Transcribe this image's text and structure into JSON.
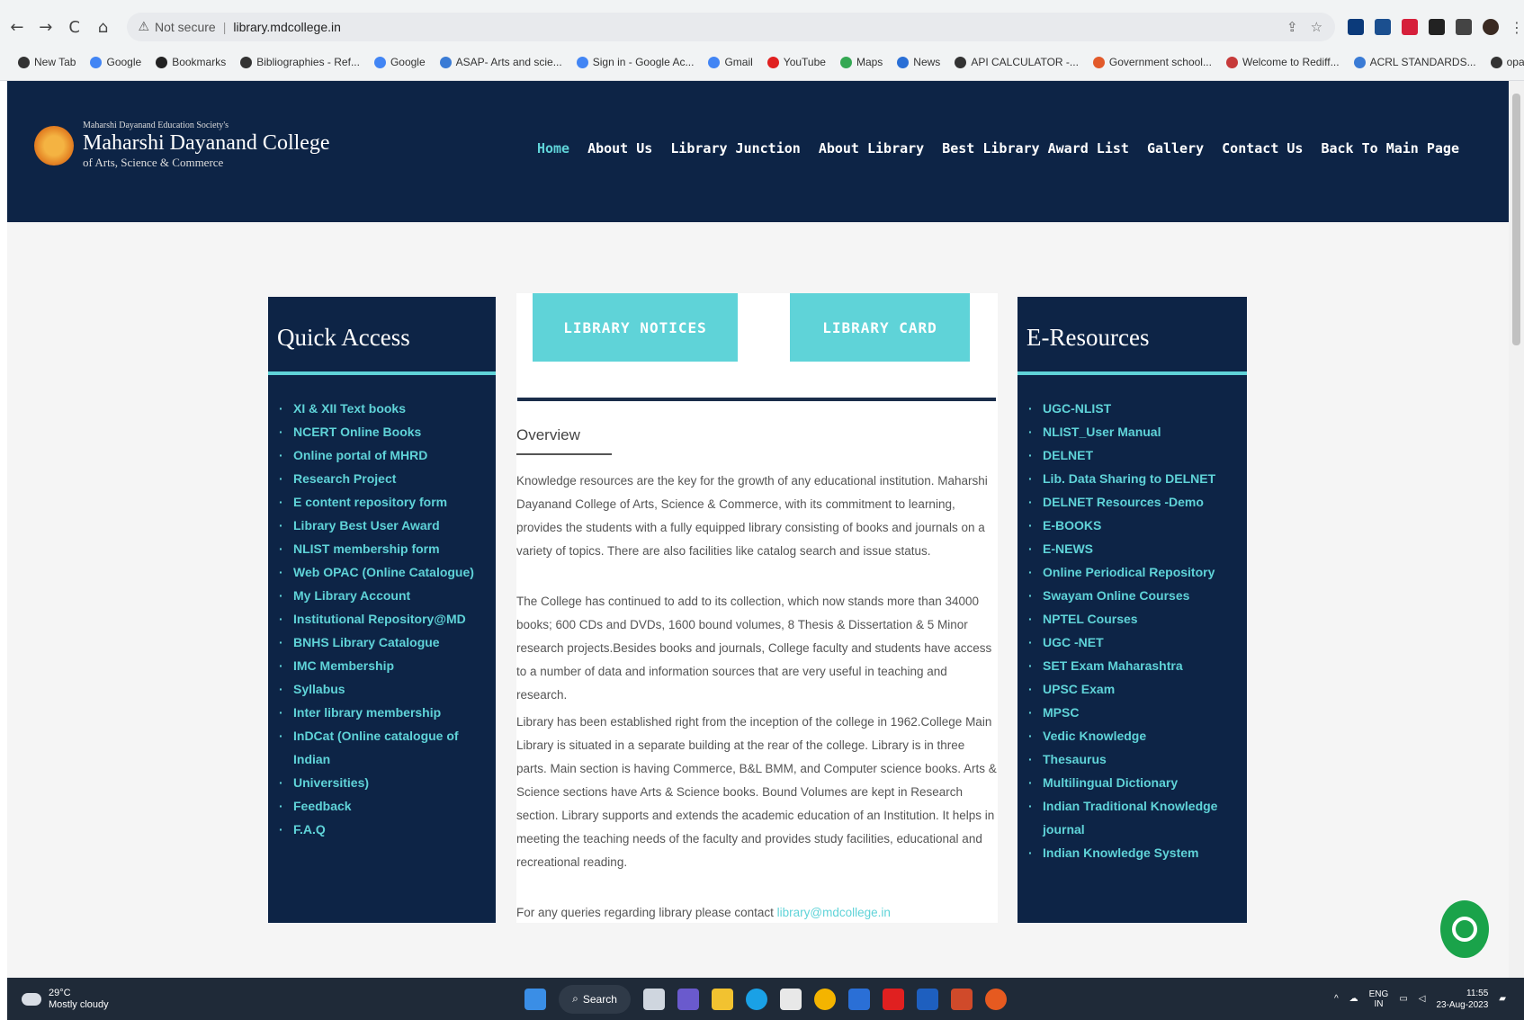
{
  "browser": {
    "nav": [
      "←",
      "→",
      "C",
      "⌂"
    ],
    "security": "Not secure",
    "url": "library.mdcollege.in",
    "bookmarks": [
      "New Tab",
      "Google",
      "Bookmarks",
      "Bibliographies - Ref...",
      "Google",
      "ASAP- Arts and scie...",
      "Sign in - Google Ac...",
      "Gmail",
      "YouTube",
      "Maps",
      "News",
      "API CALCULATOR -...",
      "Government school...",
      "Welcome to Rediff...",
      "ACRL STANDARDS...",
      "opac"
    ]
  },
  "site": {
    "society": "Maharshi Dayanand Education Society's",
    "college_name": "Maharshi Dayanand College",
    "college_sub": "of Arts, Science & Commerce",
    "menu": [
      "Home",
      "About Us",
      "Library Junction",
      "About Library",
      "Best Library Award List",
      "Gallery",
      "Contact Us",
      "Back To Main Page"
    ]
  },
  "quick_access": {
    "title": "Quick Access",
    "items": [
      "XI & XII Text books",
      "NCERT Online Books",
      "Online portal of MHRD",
      "Research Project",
      "E content repository form",
      "Library Best User Award",
      "NLIST membership form",
      "Web OPAC (Online Catalogue)",
      "My Library Account",
      "Institutional Repository@MD",
      "BNHS Library Catalogue",
      "IMC Membership",
      "Syllabus",
      "Inter library membership",
      "InDCat (Online catalogue of Indian",
      "Universities)",
      "Feedback",
      "F.A.Q"
    ]
  },
  "center": {
    "btn_notices": "LIBRARY NOTICES",
    "btn_card": "LIBRARY CARD",
    "overview_title": "Overview",
    "para1": "Knowledge resources are the key for the growth of any educational institution. Maharshi Dayanand College of Arts, Science & Commerce, with its commitment to learning, provides the students with a fully equipped library consisting of books and journals on a variety of topics. There are also facilities like catalog search and issue status.",
    "para2": "The College has continued to add to its collection, which now stands more than 34000 books; 600 CDs and DVDs, 1600 bound volumes, 8 Thesis & Dissertation & 5 Minor research projects.Besides books and journals, College faculty and students have access to a number of data and information sources that are very useful in teaching and research.",
    "para3": "Library has been established right from the inception of the college in 1962.College Main Library is situated in a separate building at the rear of the college. Library is in three parts. Main section is having Commerce, B&L BMM, and Computer science books. Arts & Science sections have Arts & Science books. Bound Volumes are kept in Research section. Library supports and extends the academic education of an Institution. It helps in meeting the teaching needs of the faculty and provides study facilities, educational and recreational reading.",
    "contact_prefix": "For any queries regarding library please contact ",
    "contact_email": "library@mdcollege.in"
  },
  "e_resources": {
    "title": "E-Resources",
    "items": [
      "UGC-NLIST",
      "NLIST_User Manual",
      "DELNET",
      "Lib. Data Sharing to DELNET",
      "DELNET Resources -Demo",
      "E-BOOKS",
      "E-NEWS",
      "Online Periodical Repository",
      "Swayam Online Courses",
      "NPTEL Courses",
      "UGC -NET",
      "SET Exam Maharashtra",
      "UPSC Exam",
      "MPSC",
      "Vedic Knowledge",
      "Thesaurus",
      "Multilingual Dictionary",
      "Indian Traditional Knowledge journal",
      "Indian Knowledge System"
    ]
  },
  "taskbar": {
    "temp": "29°C",
    "weather": "Mostly cloudy",
    "search": "Search",
    "lang": "ENG",
    "lang2": "IN",
    "time": "11:55",
    "date": "23-Aug-2023"
  },
  "colors": {
    "navy": "#0d2446",
    "accent": "#5fd3d8",
    "chat": "#1aa34a"
  }
}
